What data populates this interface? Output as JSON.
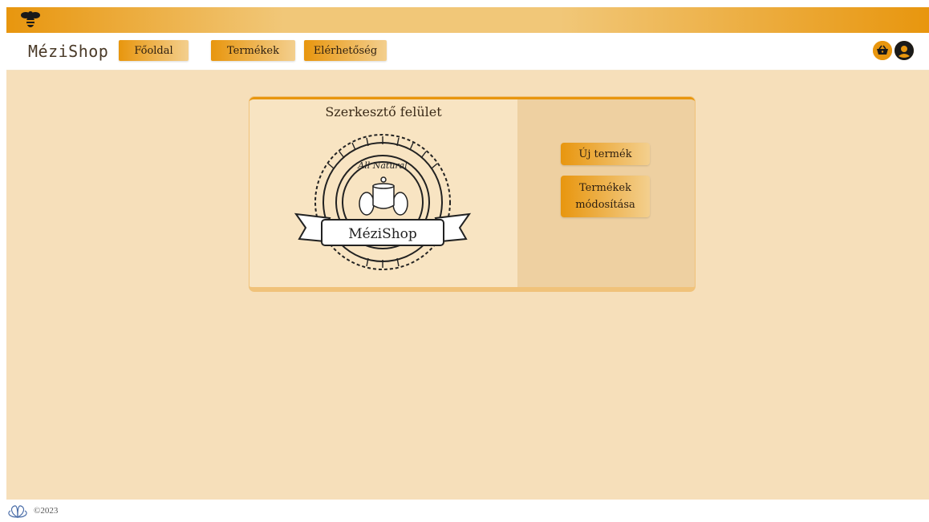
{
  "header": {
    "logo_icon": "bee-icon",
    "brand": "MéziShop",
    "nav": [
      {
        "label": "Főoldal"
      },
      {
        "label": "Termékek"
      },
      {
        "label": "Elérhetőség"
      }
    ],
    "cart_icon": "basket-icon",
    "user_icon": "user-circle-icon"
  },
  "editor": {
    "title": "Szerkesztő felület",
    "badge_top_text": "All Natural",
    "badge_ribbon_text": "MéziShop",
    "new_product_label": "Új termék",
    "edit_products_label_line1": "Termékek",
    "edit_products_label_line2": "módosítása"
  },
  "footer": {
    "icon": "flower-icon",
    "copyright": "©2023"
  },
  "colors": {
    "accent": "#e8960e",
    "accent_light": "#f3cf8e",
    "page_bg": "#f6dfba"
  }
}
